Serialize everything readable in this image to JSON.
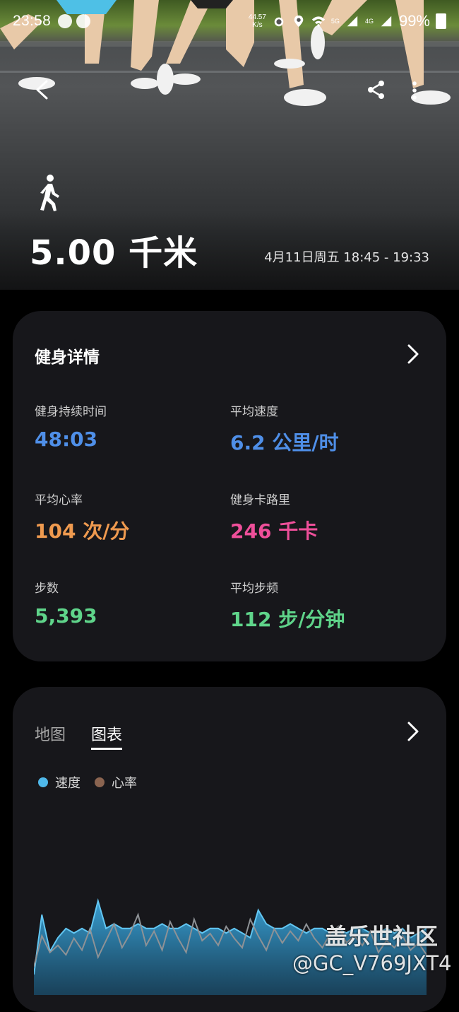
{
  "status_bar": {
    "time": "23:58",
    "net_speed_value": "44.57",
    "net_speed_unit": "K/s",
    "signal_1": "5G",
    "signal_2": "4G",
    "battery": "99%"
  },
  "hero": {
    "distance": "5.00 千米",
    "date_range": "4月11日周五 18:45 - 19:33",
    "activity_icon": "walk-icon"
  },
  "details": {
    "title": "健身详情",
    "metrics": [
      {
        "label": "健身持续时间",
        "value": "48:03",
        "color": "#4f8fe8"
      },
      {
        "label": "平均速度",
        "value": "6.2 公里/时",
        "color": "#4f8fe8"
      },
      {
        "label": "平均心率",
        "value": "104 次/分",
        "color": "#ef9a4f"
      },
      {
        "label": "健身卡路里",
        "value": "246 千卡",
        "color": "#ef4f9a"
      },
      {
        "label": "步数",
        "value": "5,393",
        "color": "#5fd48a"
      },
      {
        "label": "平均步频",
        "value": "112 步/分钟",
        "color": "#5fd48a"
      }
    ]
  },
  "chart_card": {
    "tabs": [
      "地图",
      "图表"
    ],
    "active_tab": "图表",
    "legend": [
      {
        "name": "速度",
        "color": "#4fb8ea"
      },
      {
        "name": "心率",
        "color": "#8a6450"
      }
    ]
  },
  "chart_data": {
    "type": "area",
    "title": "",
    "xlabel": "",
    "ylabel": "",
    "series": [
      {
        "name": "速度",
        "values": [
          5.6,
          6.9,
          6.1,
          6.4,
          6.6,
          6.5,
          6.6,
          6.5,
          7.2,
          6.6,
          6.7,
          6.6,
          6.6,
          6.7,
          6.6,
          6.6,
          6.7,
          6.6,
          6.6,
          6.7,
          6.6,
          6.5,
          6.6,
          6.6,
          6.5,
          6.6,
          6.5,
          6.4,
          7.0,
          6.7,
          6.6,
          6.6,
          6.7,
          6.6,
          6.5,
          6.6,
          6.6,
          6.5,
          6.6,
          6.5,
          6.6,
          6.6,
          6.5,
          6.5,
          6.6,
          6.5,
          6.6,
          6.4,
          6.5,
          6.6
        ]
      },
      {
        "name": "心率",
        "values": [
          92,
          105,
          98,
          101,
          97,
          104,
          99,
          108,
          96,
          103,
          110,
          100,
          106,
          114,
          101,
          107,
          99,
          111,
          104,
          98,
          112,
          103,
          106,
          101,
          109,
          104,
          100,
          112,
          105,
          99,
          108,
          102,
          107,
          103,
          110,
          104,
          100,
          106,
          109,
          102,
          105,
          101,
          107,
          98,
          103,
          100,
          105,
          99,
          102,
          97
        ]
      }
    ],
    "grid": false
  },
  "watermark": {
    "line1": "盖乐世社区",
    "line2": "@GC_V769JXT4"
  }
}
